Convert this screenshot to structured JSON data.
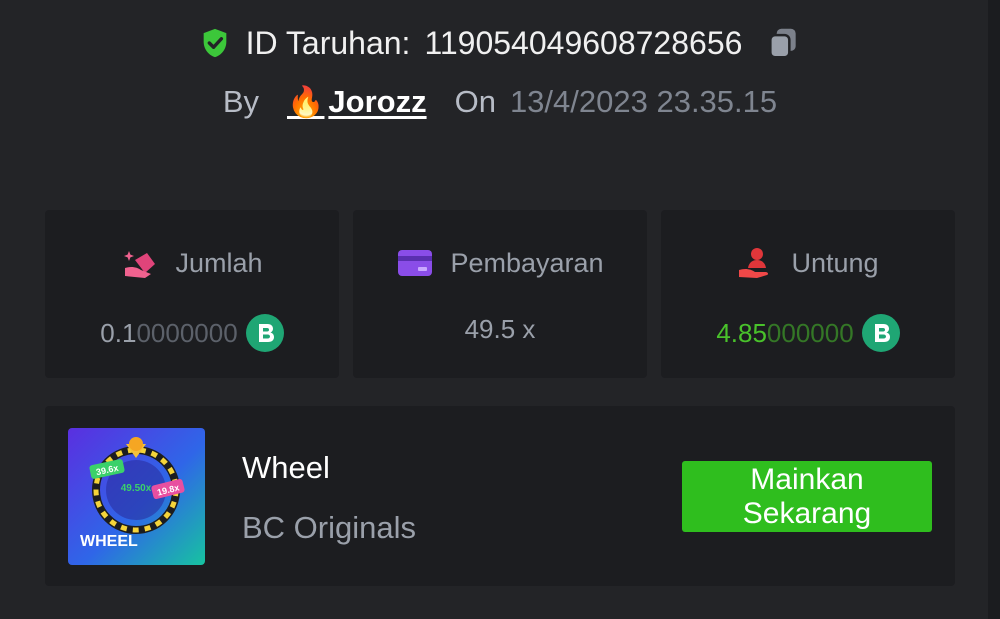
{
  "bet": {
    "id_label": "ID Taruhan:",
    "id_value": "119054049608728656",
    "by_label": "By",
    "user_emoji": "🔥",
    "username": "Jorozz",
    "on_label": "On",
    "date": "13/4/2023 23.35.15"
  },
  "stats": [
    {
      "label": "Jumlah",
      "icon": "coins-hand-icon",
      "value_main": "0.1",
      "value_dim": "0000000",
      "coin": "bc-coin-icon"
    },
    {
      "label": "Pembayaran",
      "icon": "card-icon",
      "value": "49.5 x"
    },
    {
      "label": "Untung",
      "icon": "profit-hand-icon",
      "value_main": "4.85",
      "value_dim": "000000",
      "coin": "bc-coin-icon"
    }
  ],
  "game": {
    "thumb_label": "WHEEL",
    "thumb_badges": [
      "39.6x",
      "49.50x",
      "19.8x"
    ],
    "title": "Wheel",
    "provider": "BC Originals",
    "play_button": "Mainkan\nSekarang"
  },
  "colors": {
    "background": "#232427",
    "card": "#1c1d20",
    "accent_green": "#2fbe1e",
    "profit_green": "#49c22b",
    "coin": "#1fa674"
  }
}
